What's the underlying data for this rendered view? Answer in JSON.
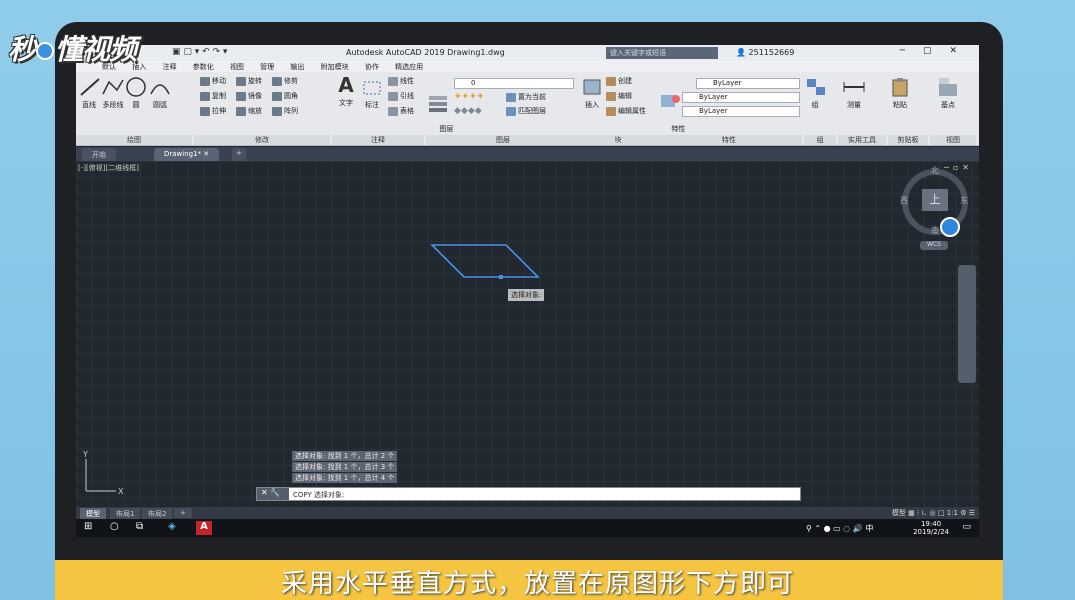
{
  "logo_text": "秒懂视频",
  "caption": "采用水平垂直方式，放置在原图形下方即可",
  "titlebar": {
    "title": "Autodesk AutoCAD 2019    Drawing1.dwg",
    "search_placeholder": "键入关键字或短语",
    "user": "251152669"
  },
  "menu": [
    "默认",
    "插入",
    "注释",
    "参数化",
    "视图",
    "管理",
    "输出",
    "附加模块",
    "协作",
    "精选应用"
  ],
  "ribbon": {
    "draw": {
      "line": "直线",
      "polyline": "多段线",
      "circle": "圆",
      "arc": "圆弧",
      "title": "绘图"
    },
    "modify": {
      "move": "移动",
      "rotate": "旋转",
      "trim": "修剪",
      "copy": "复制",
      "mirror": "镜像",
      "fillet": "圆角",
      "stretch": "拉伸",
      "scale": "缩放",
      "array": "阵列",
      "title": "修改"
    },
    "annotation": {
      "text": "文字",
      "dimension": "标注",
      "linear": "线性",
      "leader": "引线",
      "table": "表格",
      "title": "注释"
    },
    "layers": {
      "props": "图层\n特性",
      "layer_value": "0",
      "make_current": "置为当前",
      "match": "匹配图层",
      "title": "图层"
    },
    "block": {
      "insert": "插入",
      "create": "创建",
      "edit": "编辑",
      "edit_attr": "编辑属性",
      "title": "块"
    },
    "properties": {
      "match": "特性\n匹配",
      "bylayer1": "ByLayer",
      "bylayer2": "ByLayer",
      "bylayer3": "ByLayer",
      "title": "特性"
    },
    "group": {
      "group": "组",
      "title": "组"
    },
    "utilities": {
      "measure": "测量",
      "title": "实用工具"
    },
    "clipboard": {
      "paste": "粘贴",
      "title": "剪贴板"
    },
    "view": {
      "base": "基点",
      "title": "视图"
    }
  },
  "tabs": [
    {
      "label": "开始"
    },
    {
      "label": "Drawing1*"
    }
  ],
  "viewport_label": "[-][俯视][二维线框]",
  "viewcube": {
    "top": "上",
    "north": "北",
    "south": "南",
    "east": "东",
    "west": "西",
    "wcs": "WCS"
  },
  "tooltip": "选择对象:",
  "history": [
    "选择对象: 找到 1 个，总计 2 个",
    "选择对象: 找到 1 个，总计 3 个",
    "选择对象: 找到 1 个，总计 4 个"
  ],
  "command_line": "COPY 选择对象:",
  "layout_tabs": [
    "模型",
    "布局1",
    "布局2"
  ],
  "status": {
    "model": "模型",
    "scale": "1:1"
  },
  "clock": {
    "time": "19:40",
    "date": "2019/2/24"
  },
  "ime": "中"
}
